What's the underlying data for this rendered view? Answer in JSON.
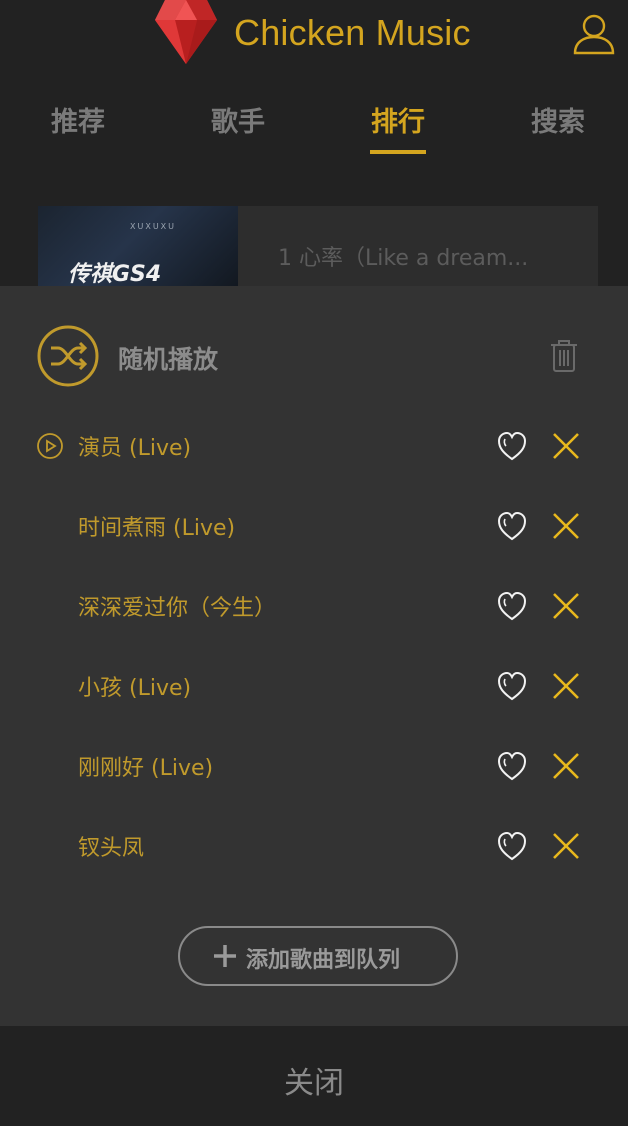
{
  "header": {
    "title": "Chicken Music",
    "logo_icon": "diamond-logo-icon",
    "user_icon": "user-icon",
    "accent_color": "#d4a51f"
  },
  "tabs": [
    {
      "label": "推荐",
      "active": false
    },
    {
      "label": "歌手",
      "active": false
    },
    {
      "label": "排行",
      "active": true
    },
    {
      "label": "搜索",
      "active": false
    }
  ],
  "background_list": {
    "cover_text": "传祺GS4",
    "cover_brand": "XUXUXU",
    "item_title": "1 心率（Like a dream..."
  },
  "playlist": {
    "mode_label": "随机播放",
    "mode_icon": "shuffle-icon",
    "clear_icon": "trash-icon",
    "songs": [
      {
        "name": "演员 (Live)",
        "playing": true
      },
      {
        "name": "时间煮雨 (Live)",
        "playing": false
      },
      {
        "name": "深深爱过你（今生）",
        "playing": false
      },
      {
        "name": "小孩 (Live)",
        "playing": false
      },
      {
        "name": "刚刚好 (Live)",
        "playing": false
      },
      {
        "name": "钗头凤",
        "playing": false
      }
    ],
    "add_button_label": "添加歌曲到队列",
    "close_label": "关闭"
  }
}
